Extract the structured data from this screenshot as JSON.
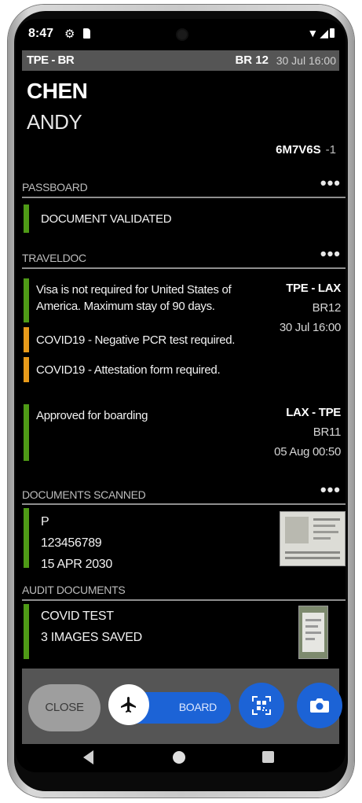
{
  "status_bar": {
    "time": "8:47",
    "icons": [
      "gear-icon",
      "sim-card-icon"
    ],
    "right_icons": [
      "wifi-icon",
      "signal-icon",
      "battery-icon"
    ]
  },
  "header": {
    "route": "TPE - BR",
    "flight": "BR 12",
    "date": "30 Jul 16:00"
  },
  "passenger": {
    "surname": "CHEN",
    "given_name": "ANDY",
    "pnr": "6M7V6S",
    "pnr_suffix": "-1"
  },
  "passboard": {
    "title": "PASSBOARD",
    "item": {
      "text": "DOCUMENT VALIDATED",
      "status": "green"
    }
  },
  "traveldoc": {
    "title": "TRAVELDOC",
    "items": [
      {
        "text": "Visa is not required for United States of America. Maximum stay of 90 days.",
        "status": "green"
      },
      {
        "text": "COVID19 - Negative PCR test required.",
        "status": "orange"
      },
      {
        "text": "COVID19 - Attestation form required.",
        "status": "orange"
      },
      {
        "text": "Approved for boarding",
        "status": "green"
      }
    ],
    "outbound": {
      "route": "TPE - LAX",
      "flight": "BR12",
      "date": "30 Jul 16:00"
    },
    "inbound": {
      "route": "LAX - TPE",
      "flight": "BR11",
      "date": "05 Aug 00:50"
    }
  },
  "documents_scanned": {
    "title": "DOCUMENTS SCANNED",
    "type": "P",
    "number": "123456789",
    "expiry": "15 APR 2030"
  },
  "audit_documents": {
    "title": "AUDIT DOCUMENTS",
    "name": "COVID TEST",
    "images": "3 IMAGES SAVED"
  },
  "actions": {
    "close": "CLOSE",
    "board": "BOARD"
  },
  "colors": {
    "green": "#4e9a16",
    "orange": "#e89a1a",
    "blue": "#1c63d6",
    "panel": "#555555"
  }
}
